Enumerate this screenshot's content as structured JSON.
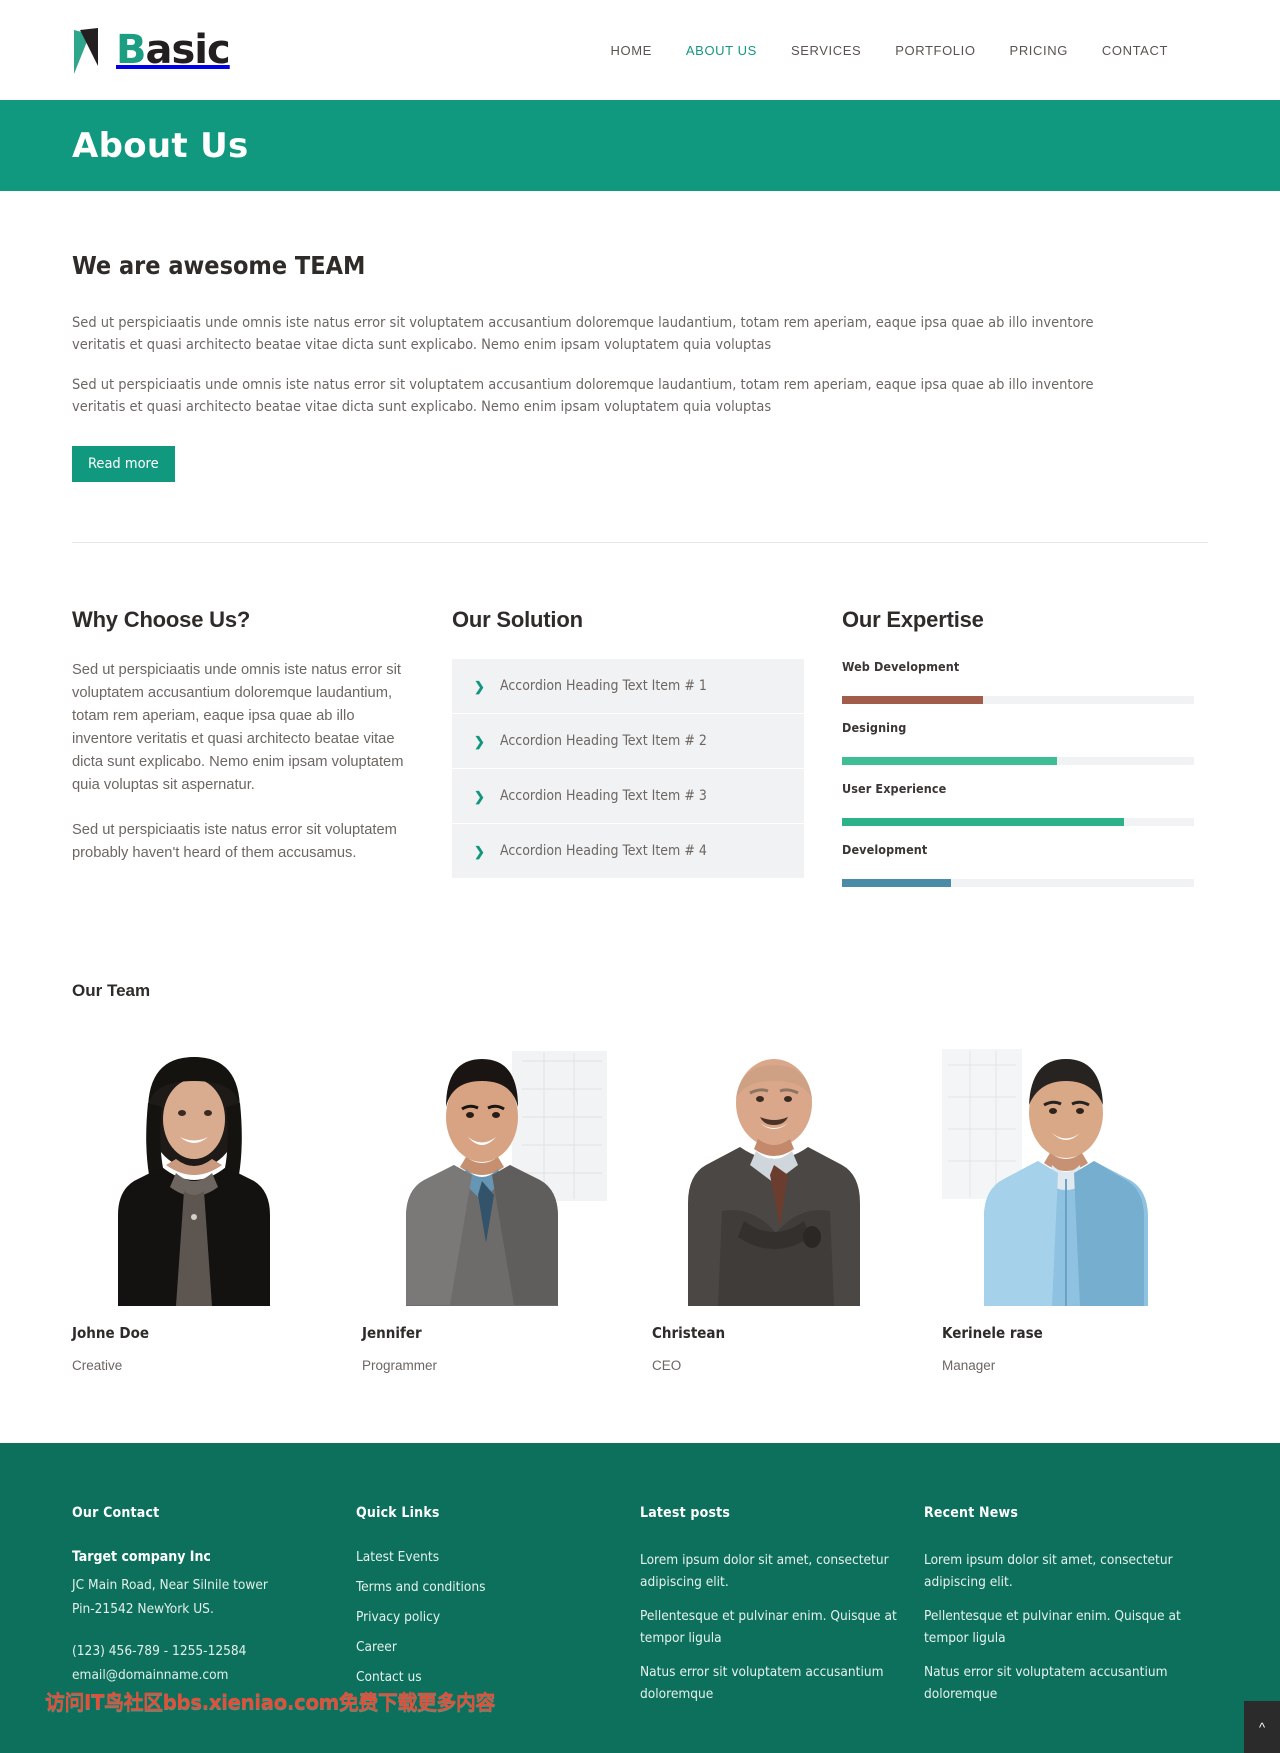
{
  "brand": {
    "logo_b": "B",
    "logo_rest": "asic",
    "mark_icon": "flag-mark-icon"
  },
  "nav": {
    "items": [
      {
        "label": "HOME",
        "active": false
      },
      {
        "label": "ABOUT US",
        "active": true
      },
      {
        "label": "SERVICES",
        "active": false
      },
      {
        "label": "PORTFOLIO",
        "active": false
      },
      {
        "label": "PRICING",
        "active": false
      },
      {
        "label": "CONTACT",
        "active": false
      }
    ]
  },
  "banner": {
    "title": "About Us"
  },
  "intro": {
    "heading": "We are awesome TEAM",
    "paragraph1": "Sed ut perspiciaatis unde omnis iste natus error sit voluptatem accusantium doloremque laudantium, totam rem aperiam, eaque ipsa quae ab illo inventore veritatis et quasi architecto beatae vitae dicta sunt explicabo. Nemo enim ipsam voluptatem quia voluptas",
    "paragraph2": "Sed ut perspiciaatis unde omnis iste natus error sit voluptatem accusantium doloremque laudantium, totam rem aperiam, eaque ipsa quae ab illo inventore veritatis et quasi architecto beatae vitae dicta sunt explicabo. Nemo enim ipsam voluptatem quia voluptas",
    "button_label": "Read more"
  },
  "why_choose": {
    "heading": "Why Choose Us?",
    "paragraph1": "Sed ut perspiciaatis unde omnis iste natus error sit voluptatem accusantium doloremque laudantium, totam rem aperiam, eaque ipsa quae ab illo inventore veritatis et quasi architecto beatae vitae dicta sunt explicabo. Nemo enim ipsam voluptatem quia voluptas sit aspernatur.",
    "paragraph2": "Sed ut perspiciaatis iste natus error sit voluptatem probably haven't heard of them accusamus."
  },
  "solution": {
    "heading": "Our Solution",
    "chevron_icon": "chevron-right-icon",
    "items": [
      {
        "label": "Accordion Heading Text Item # 1"
      },
      {
        "label": "Accordion Heading Text Item # 2"
      },
      {
        "label": "Accordion Heading Text Item # 3"
      },
      {
        "label": "Accordion Heading Text Item # 4"
      }
    ]
  },
  "expertise": {
    "heading": "Our Expertise",
    "track_color": "#f1f2f3",
    "skills": [
      {
        "label": "Web Development",
        "percent": 40,
        "color": "#a25c4c"
      },
      {
        "label": "Designing",
        "percent": 61,
        "color": "#3fbe96"
      },
      {
        "label": "User Experience",
        "percent": 80,
        "color": "#2cb189"
      },
      {
        "label": "Development",
        "percent": 31,
        "color": "#4a8ba8"
      }
    ]
  },
  "team": {
    "heading": "Our Team",
    "members": [
      {
        "name": "Johne Doe",
        "role": "Creative",
        "photo": "woman-dark-hair-black-jacket"
      },
      {
        "name": "Jennifer",
        "role": "Programmer",
        "photo": "young-man-grey-suit-blue-tie"
      },
      {
        "name": "Christean",
        "role": "CEO",
        "photo": "older-man-bald-grey-suit"
      },
      {
        "name": "Kerinele rase",
        "role": "Manager",
        "photo": "man-light-blue-shirt"
      }
    ]
  },
  "footer": {
    "contact": {
      "heading": "Our Contact",
      "company": "Target company Inc",
      "address_line1": "JC Main Road, Near Silnile tower",
      "address_line2": "Pin-21542 NewYork US.",
      "phone": "(123) 456-789 - 1255-12584",
      "email": "email@domainname.com"
    },
    "quick_links": {
      "heading": "Quick Links",
      "items": [
        {
          "label": "Latest Events"
        },
        {
          "label": "Terms and conditions"
        },
        {
          "label": "Privacy policy"
        },
        {
          "label": "Career"
        },
        {
          "label": "Contact us"
        }
      ]
    },
    "latest_posts": {
      "heading": "Latest posts",
      "items": [
        {
          "text": "Lorem ipsum dolor sit amet, consectetur adipiscing elit."
        },
        {
          "text": "Pellentesque et pulvinar enim. Quisque at tempor ligula"
        },
        {
          "text": "Natus error sit voluptatem accusantium doloremque"
        }
      ]
    },
    "recent_news": {
      "heading": "Recent News",
      "items": [
        {
          "text": "Lorem ipsum dolor sit amet, consectetur adipiscing elit."
        },
        {
          "text": "Pellentesque et pulvinar enim. Quisque at tempor ligula"
        },
        {
          "text": "Natus error sit voluptatem accusantium doloremque"
        }
      ]
    },
    "watermark": "访问IT鸟社区bbs.xieniao.com免费下载更多内容",
    "to_top_icon": "chevron-up-icon"
  },
  "colors": {
    "brand_teal": "#119980",
    "footer_teal": "#0c705c",
    "accent_link": "#159684",
    "body_text": "#6d6662",
    "heading_text": "#2f2b29"
  }
}
